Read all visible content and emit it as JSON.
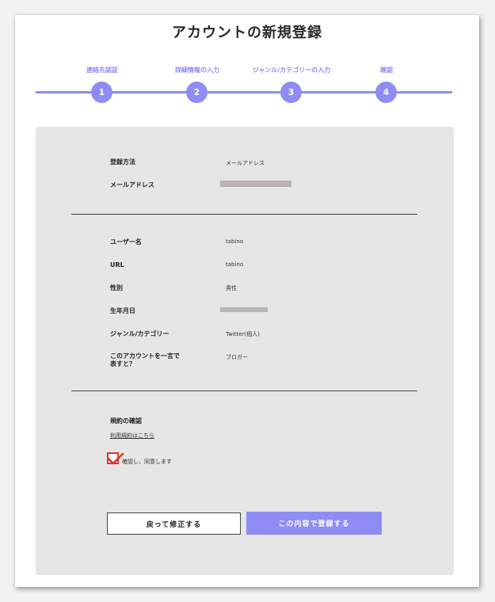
{
  "page_title": "アカウントの新規登録",
  "steps": [
    {
      "label": "連絡先認証",
      "number": "1"
    },
    {
      "label": "詳細情報の入力",
      "number": "2"
    },
    {
      "label": "ジャンル/カテゴリーの入力",
      "number": "3"
    },
    {
      "label": "確認",
      "number": "4"
    }
  ],
  "account_section": {
    "registration_method": {
      "label": "登録方法",
      "value": "メールアドレス"
    },
    "email": {
      "label": "メールアドレス",
      "value_redacted": true
    }
  },
  "profile_section": {
    "username": {
      "label": "ユーザー名",
      "value": "tabino"
    },
    "url": {
      "label": "URL",
      "value": "tabino"
    },
    "gender": {
      "label": "性別",
      "value": "男性"
    },
    "birthdate": {
      "label": "生年月日",
      "value_redacted": true
    },
    "genre": {
      "label": "ジャンル/カテゴリー",
      "value": "Twitter(個人)"
    },
    "one_word": {
      "label": "このアカウントを一言で表すと？",
      "value": "ブロガー"
    }
  },
  "terms": {
    "title": "規約の確認",
    "link": "利用規約はこちら",
    "agree_label": "確認し、同意します",
    "agreed": true
  },
  "buttons": {
    "back": "戻って修正する",
    "submit": "この内容で登録する"
  },
  "colors": {
    "accent": "#8f8cf3",
    "card_bg": "#e6e6e6",
    "check": "#e0352b"
  }
}
